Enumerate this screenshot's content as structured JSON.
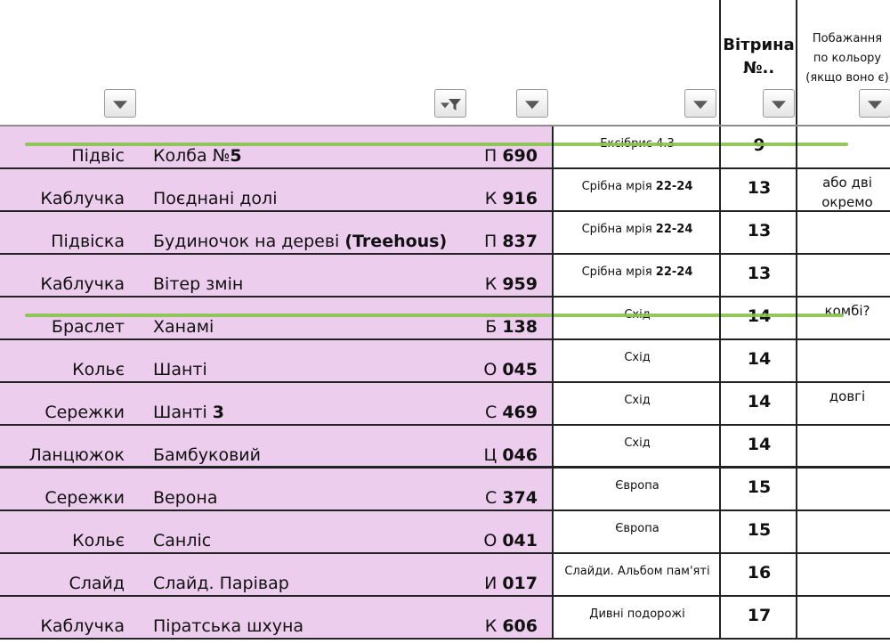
{
  "header": {
    "vitrina_line1": "Вітрина",
    "vitrina_line2": "№..",
    "wish_line1": "Побажання",
    "wish_line2": "по кольору",
    "wish_line3": "(якщо воно є)"
  },
  "filters": {
    "active_column": "name",
    "icon": "filter-dropdown-icon",
    "active_icon": "funnel-icon"
  },
  "colors": {
    "row_bg": "#edcdee",
    "strike": "#86c24a"
  },
  "rows": [
    {
      "type": "Підвіс",
      "name": "Колба №",
      "name_bold": "5",
      "code_letter": "П",
      "code_num": "690",
      "collection": "Ексібрис 4.3",
      "collection_bold": "",
      "vitrina": "9",
      "wish": "",
      "struck": true
    },
    {
      "type": "Каблучка",
      "name": "Поєднані долі",
      "name_bold": "",
      "code_letter": "К",
      "code_num": "916",
      "collection": "Срібна мрія",
      "collection_bold": "22-24",
      "vitrina": "13",
      "wish": "або дві окремо",
      "struck": false
    },
    {
      "type": "Підвіска",
      "name": "Будиночок на дереві",
      "name_bold": "(Treehous)",
      "code_letter": "П",
      "code_num": "837",
      "collection": "Срібна мрія",
      "collection_bold": "22-24",
      "vitrina": "13",
      "wish": "",
      "struck": false
    },
    {
      "type": "Каблучка",
      "name": "Вітер змін",
      "name_bold": "",
      "code_letter": "К",
      "code_num": "959",
      "collection": "Срібна мрія",
      "collection_bold": "22-24",
      "vitrina": "13",
      "wish": "",
      "struck": false
    },
    {
      "type": "Браслет",
      "name": "Ханамі",
      "name_bold": "",
      "code_letter": "Б",
      "code_num": "138",
      "collection": "Схід",
      "collection_bold": "",
      "vitrina": "14",
      "wish": "комбі?",
      "struck": true
    },
    {
      "type": "Кольє",
      "name": "Шанті",
      "name_bold": "",
      "code_letter": "О",
      "code_num": "045",
      "collection": "Схід",
      "collection_bold": "",
      "vitrina": "14",
      "wish": "",
      "struck": false
    },
    {
      "type": "Сережки",
      "name": "Шанті",
      "name_bold": "3",
      "code_letter": "С",
      "code_num": "469",
      "collection": "Схід",
      "collection_bold": "",
      "vitrina": "14",
      "wish": "довгі",
      "struck": false
    },
    {
      "type": "Ланцюжок",
      "name": "Бамбуковий",
      "name_bold": "",
      "code_letter": "Ц",
      "code_num": "046",
      "collection": "Схід",
      "collection_bold": "",
      "vitrina": "14",
      "wish": "",
      "struck": false
    },
    {
      "type": "Сережки",
      "name": "Верона",
      "name_bold": "",
      "code_letter": "С",
      "code_num": "374",
      "collection": "Європа",
      "collection_bold": "",
      "vitrina": "15",
      "wish": "",
      "struck": false
    },
    {
      "type": "Кольє",
      "name": "Санліс",
      "name_bold": "",
      "code_letter": "О",
      "code_num": "041",
      "collection": "Європа",
      "collection_bold": "",
      "vitrina": "15",
      "wish": "",
      "struck": false
    },
    {
      "type": "Слайд",
      "name": "Слайд. Парівар",
      "name_bold": "",
      "code_letter": "И",
      "code_num": "017",
      "collection": "Слайди. Альбом пам'яті",
      "collection_bold": "",
      "vitrina": "16",
      "wish": "",
      "struck": false
    },
    {
      "type": "Каблучка",
      "name": "Піратська шхуна",
      "name_bold": "",
      "code_letter": "К",
      "code_num": "606",
      "collection": "Дивні подорожі",
      "collection_bold": "",
      "vitrina": "17",
      "wish": "",
      "struck": false
    }
  ]
}
